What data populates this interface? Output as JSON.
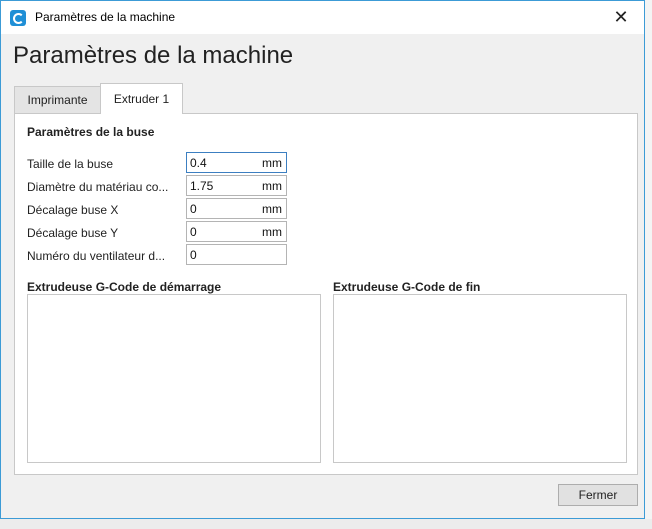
{
  "window": {
    "title": "Paramètres de la machine",
    "close_glyph": "✕"
  },
  "heading": "Paramètres de la machine",
  "tabs": [
    {
      "label": "Imprimante",
      "active": false
    },
    {
      "label": "Extruder 1",
      "active": true
    }
  ],
  "nozzle_section": {
    "title": "Paramètres de la buse",
    "fields": [
      {
        "label": "Taille de la buse",
        "value": "0.4",
        "unit": "mm"
      },
      {
        "label": "Diamètre du matériau co...",
        "value": "1.75",
        "unit": "mm"
      },
      {
        "label": "Décalage buse X",
        "value": "0",
        "unit": "mm"
      },
      {
        "label": "Décalage buse Y",
        "value": "0",
        "unit": "mm"
      },
      {
        "label": "Numéro du ventilateur d...",
        "value": "0",
        "unit": ""
      }
    ]
  },
  "gcode": {
    "start_title": "Extrudeuse G-Code de démarrage",
    "end_title": "Extrudeuse G-Code de fin",
    "start_value": "",
    "end_value": ""
  },
  "footer": {
    "close_button": "Fermer"
  },
  "colors": {
    "accent": "#3c9bd6",
    "app_icon": "#1f8fd6"
  }
}
